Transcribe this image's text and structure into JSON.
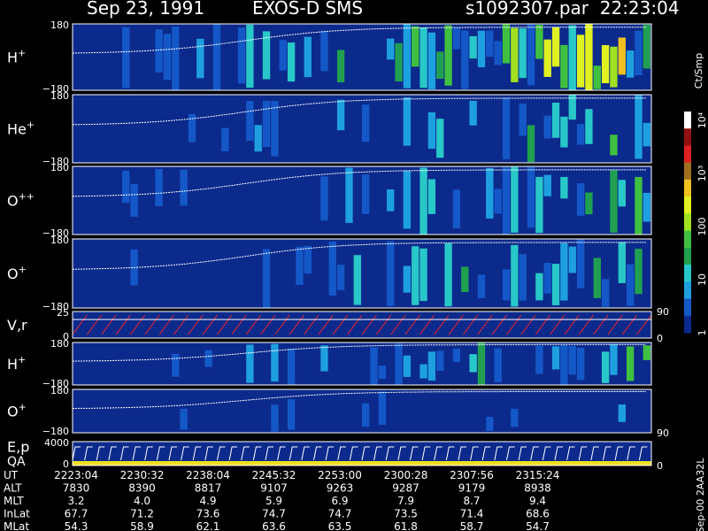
{
  "header": {
    "date": "Sep 23, 1991",
    "instrument": "EXOS-D SMS",
    "file_time": "s1092307.par  22:23:04"
  },
  "colors": {
    "background": "#000000",
    "panel_fill": "#0c2a8c",
    "trace": "#ffffff",
    "velocity_trace": "#ff2020"
  },
  "colorbar": {
    "unit": "Ct/Smp",
    "tick_labels": [
      "1",
      "10",
      "100",
      "10³",
      "10⁴"
    ],
    "colors": [
      "#0c2a8c",
      "#1458c8",
      "#1ea0e0",
      "#28c8c8",
      "#20a050",
      "#40c040",
      "#a0e020",
      "#e0f020",
      "#f0c020",
      "#a07020",
      "#e02020",
      "#901010",
      "#ffffff"
    ]
  },
  "panels": [
    {
      "label": "H",
      "sup": "+",
      "ytop": "180",
      "ybot": "−180"
    },
    {
      "label": "He",
      "sup": "+",
      "ytop": "180",
      "ybot": "−180"
    },
    {
      "label": "O",
      "sup": "++",
      "ytop": "180",
      "ybot": "−180"
    },
    {
      "label": "O",
      "sup": "+",
      "ytop": "180",
      "ybot": "−180"
    },
    {
      "label": "V,r",
      "sup": "",
      "ytop": "25",
      "ybot": "0",
      "right_top": "90",
      "right_bot": "0"
    },
    {
      "label": "H",
      "sup": "+",
      "ytop": "180",
      "ybot": "−180"
    },
    {
      "label": "O",
      "sup": "+",
      "ytop": "180",
      "ybot": "−180",
      "right_bot": "90"
    },
    {
      "label": "E,p",
      "label2": "QA",
      "ytop": "4000",
      "ybot": "0",
      "right_bot": "0"
    }
  ],
  "right_footer_note": "Sep-00 2AA32L",
  "footer": {
    "row_labels": [
      "UT",
      "ALT",
      "MLT",
      "InLat",
      "MLat"
    ],
    "columns": [
      [
        "2223:04",
        "7830",
        "3.2",
        "67.7",
        "54.3"
      ],
      [
        "2230:32",
        "8390",
        "4.0",
        "71.2",
        "58.9"
      ],
      [
        "2238:04",
        "8817",
        "4.9",
        "73.6",
        "62.1"
      ],
      [
        "2245:32",
        "9107",
        "5.9",
        "74.7",
        "63.6"
      ],
      [
        "2253:00",
        "9263",
        "6.9",
        "74.7",
        "63.5"
      ],
      [
        "2300:28",
        "9287",
        "7.9",
        "73.5",
        "61.8"
      ],
      [
        "2307:56",
        "9179",
        "8.7",
        "71.4",
        "58.7"
      ],
      [
        "2315:24",
        "8938",
        "9.4",
        "68.6",
        "54.7"
      ]
    ]
  },
  "chart_data": {
    "type": "heatmap",
    "title": "Sep 23, 1991   EXOS-D SMS",
    "x": [
      "2223:04",
      "2230:32",
      "2238:04",
      "2245:32",
      "2253:00",
      "2300:28",
      "2307:56",
      "2315:24"
    ],
    "xlabel": "UT",
    "series": [
      {
        "name": "H+",
        "ylim": [
          -180,
          180
        ]
      },
      {
        "name": "He+",
        "ylim": [
          -180,
          180
        ]
      },
      {
        "name": "O++",
        "ylim": [
          -180,
          180
        ]
      },
      {
        "name": "O+",
        "ylim": [
          -180,
          180
        ]
      },
      {
        "name": "V,r",
        "ylim": [
          0,
          25
        ]
      },
      {
        "name": "H+",
        "ylim": [
          -180,
          180
        ]
      },
      {
        "name": "O+",
        "ylim": [
          -180,
          180
        ]
      },
      {
        "name": "E,p",
        "ylim": [
          0,
          4000
        ]
      }
    ],
    "colorbar_range": [
      1,
      10000
    ],
    "colorbar_scale": "log",
    "colorbar_label": "Ct/Smp"
  }
}
